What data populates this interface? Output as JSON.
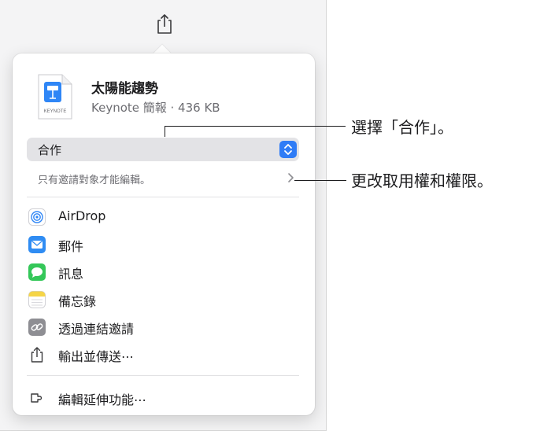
{
  "document": {
    "title": "太陽能趨勢",
    "meta": "Keynote 簡報 · 436 KB",
    "icon_label": "KEYNOTE"
  },
  "collaboration": {
    "selected": "合作",
    "access_text": "只有邀請對象才能編輯。"
  },
  "menu": [
    {
      "label": "AirDrop",
      "icon": "airdrop-icon"
    },
    {
      "label": "郵件",
      "icon": "mail-icon"
    },
    {
      "label": "訊息",
      "icon": "messages-icon"
    },
    {
      "label": "備忘錄",
      "icon": "notes-icon"
    },
    {
      "label": "透過連結邀請",
      "icon": "link-icon"
    },
    {
      "label": "輸出並傳送⋯",
      "icon": "export-icon"
    }
  ],
  "extensions": {
    "label": "編輯延伸功能⋯",
    "icon": "extensions-icon"
  },
  "callouts": {
    "choose_collab": "選擇「合作」。",
    "change_access": "更改取用權和權限。"
  },
  "colors": {
    "accent": "#2f7cf6",
    "mail": "#2f8cf3",
    "messages": "#34c759",
    "notes": "#f5d547"
  }
}
